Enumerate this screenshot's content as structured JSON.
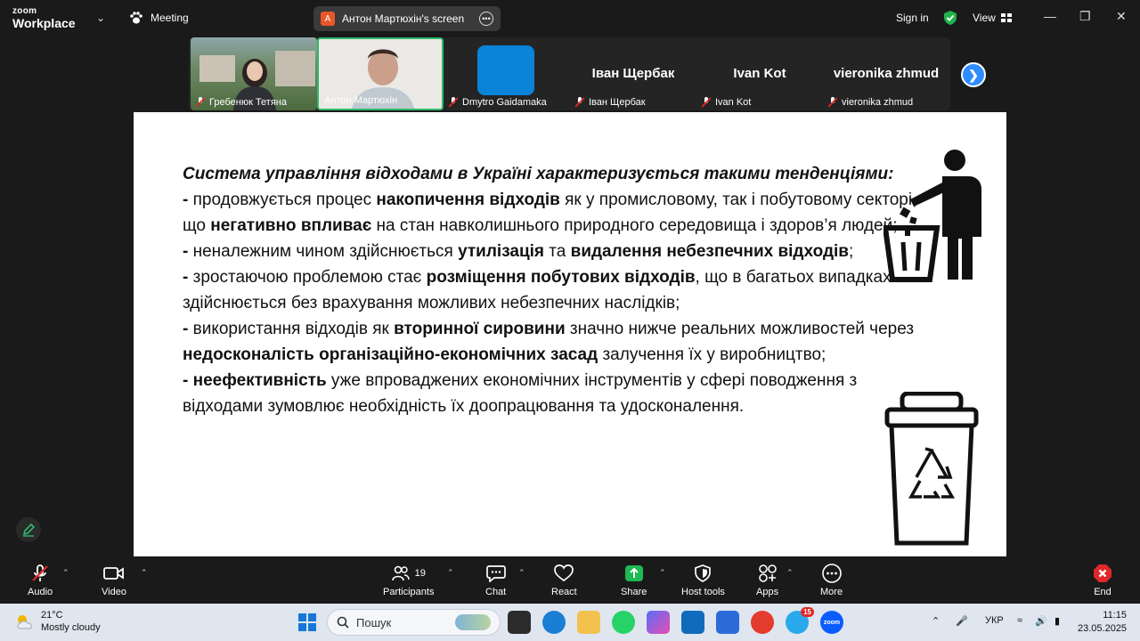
{
  "app": {
    "logo_top": "zoom",
    "logo_bottom": "Workplace",
    "meeting_label": "Meeting",
    "share_badge": "A",
    "share_title": "Антон Мартюхін's screen",
    "sign_in": "Sign in",
    "view_label": "View"
  },
  "participants": [
    {
      "name": "Гребенюк Тетяна",
      "display": ""
    },
    {
      "name": "Антон Мартюхін",
      "display": ""
    },
    {
      "name": "Dmytro Gaidamaka",
      "display": ""
    },
    {
      "name": "Іван Щербак",
      "display": "Іван Щербак"
    },
    {
      "name": "Ivan Kot",
      "display": "Ivan Kot"
    },
    {
      "name": "vieronika zhmud",
      "display": "vieronika zhmud"
    }
  ],
  "slide": {
    "heading": "Система управління відходами в Україні характеризується такими тенденціями:",
    "p1_a": "- ",
    "p1_b": "продовжується процес ",
    "p1_c": "накопичення відходів",
    "p1_d": " як у промисловому, так і побутовому секторі, що ",
    "p1_e": "негативно впливає",
    "p1_f": " на стан навколишнього природного середовища і здоров’я людей;",
    "p2_a": "- ",
    "p2_b": "неналежним чином здійснюється ",
    "p2_c": "утилізація",
    "p2_d": " та ",
    "p2_e": "видалення небезпечних відходів",
    "p2_f": ";",
    "p3_a": "- ",
    "p3_b": "зростаючою проблемою стає ",
    "p3_c": "розміщення побутових відходів",
    "p3_d": ", що в багатьох випадках здійснюється без врахування можливих небезпечних наслідків;",
    "p4_a": "- ",
    "p4_b": "використання відходів як ",
    "p4_c": "вторинної сировини",
    "p4_d": " значно нижче реальних можливостей через ",
    "p4_e": "недосконаліcть організаційно-економічних засад",
    "p4_f": " залучення їх у виробництво;",
    "p5_a": "- ",
    "p5_b": "неефективність",
    "p5_c": " уже впроваджених економічних інструментів у сфері поводження з відходами зумовлює необхідність їх доопрацювання та удосконалення."
  },
  "toolbar": {
    "audio": "Audio",
    "video": "Video",
    "participants": "Participants",
    "participants_count": "19",
    "chat": "Chat",
    "react": "React",
    "share": "Share",
    "host_tools": "Host tools",
    "apps": "Apps",
    "more": "More",
    "end": "End"
  },
  "taskbar": {
    "temp": "21°C",
    "weather": "Mostly cloudy",
    "search_placeholder": "Пошук",
    "lang": "УКР",
    "time": "11:15",
    "date": "23.05.2025",
    "telegram_badge": "15",
    "zoom_label": "zoom"
  },
  "colors": {
    "accent_blue": "#2d8cff",
    "active_tile": "#2fb96b",
    "share_green": "#1db954",
    "end_red": "#e02828"
  }
}
